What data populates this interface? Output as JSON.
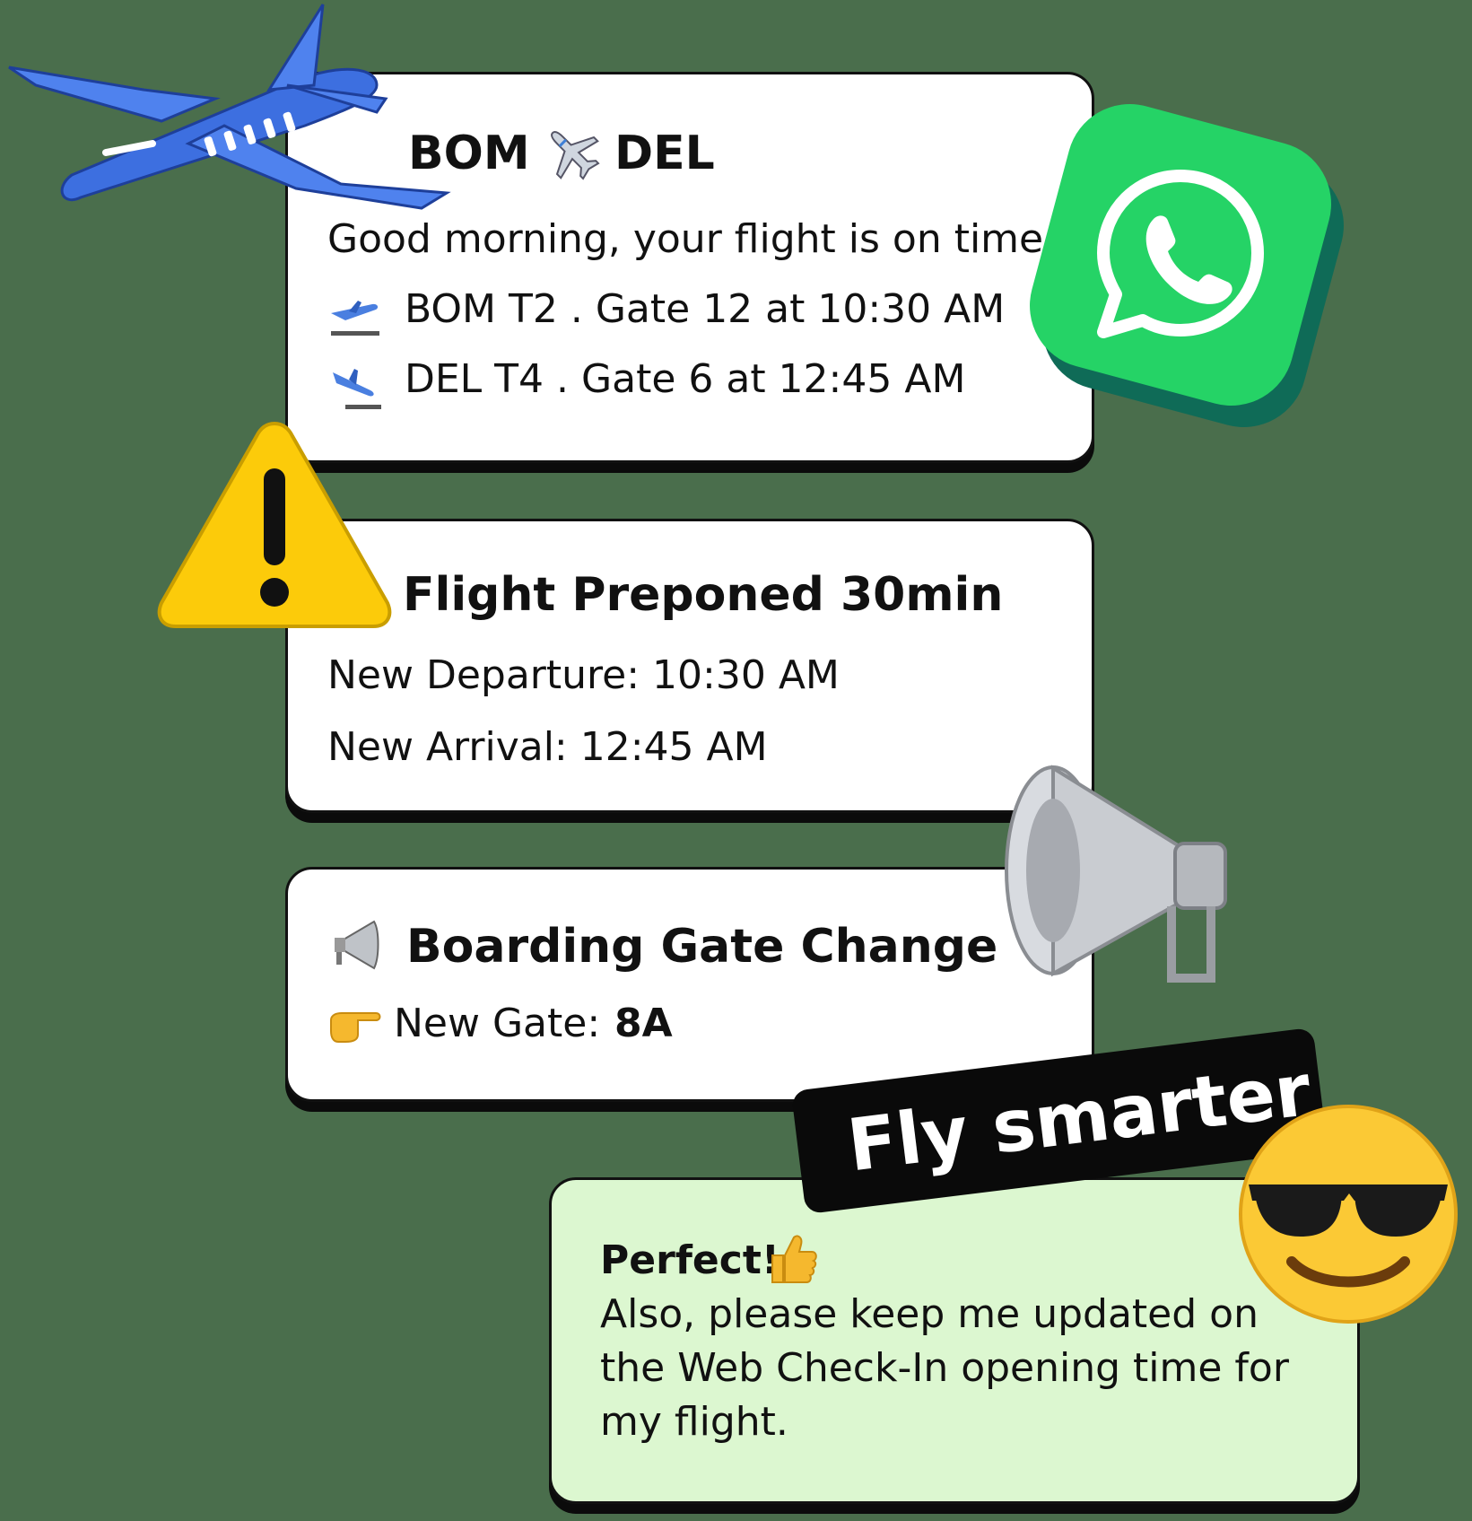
{
  "card1": {
    "origin": "BOM",
    "destination": "DEL",
    "message": "Good morning, your flight is on time",
    "departure_line": "BOM T2 . Gate 12 at 10:30 AM",
    "arrival_line": "DEL T4 . Gate 6 at 12:45 AM"
  },
  "card2": {
    "title": "Flight Preponed 30min",
    "departure": "New Departure: 10:30 AM",
    "arrival": "New Arrival: 12:45 AM"
  },
  "card3": {
    "title": "Boarding Gate Change",
    "gate_label": "New Gate:",
    "gate_value": "8A"
  },
  "banner": {
    "text": "Fly smarter"
  },
  "reply": {
    "heading": "Perfect!",
    "line1": "Also, please keep me updated on",
    "line2": "the Web Check-In opening time for",
    "line3": "my flight."
  },
  "colors": {
    "background": "#4a6e4c",
    "card": "#ffffff",
    "reply_card": "#dcf7d0",
    "whatsapp": "#25d366",
    "warning": "#fccb0a",
    "airplane": "#3d6fe0"
  },
  "icons": [
    "airplane-sticker-icon",
    "whatsapp-icon",
    "warning-icon",
    "megaphone-sticker-icon",
    "sunglasses-emoji-icon",
    "airplane-emoji-icon",
    "departure-icon",
    "arrival-icon",
    "loudspeaker-icon",
    "pointing-right-icon",
    "thumbs-up-icon"
  ]
}
